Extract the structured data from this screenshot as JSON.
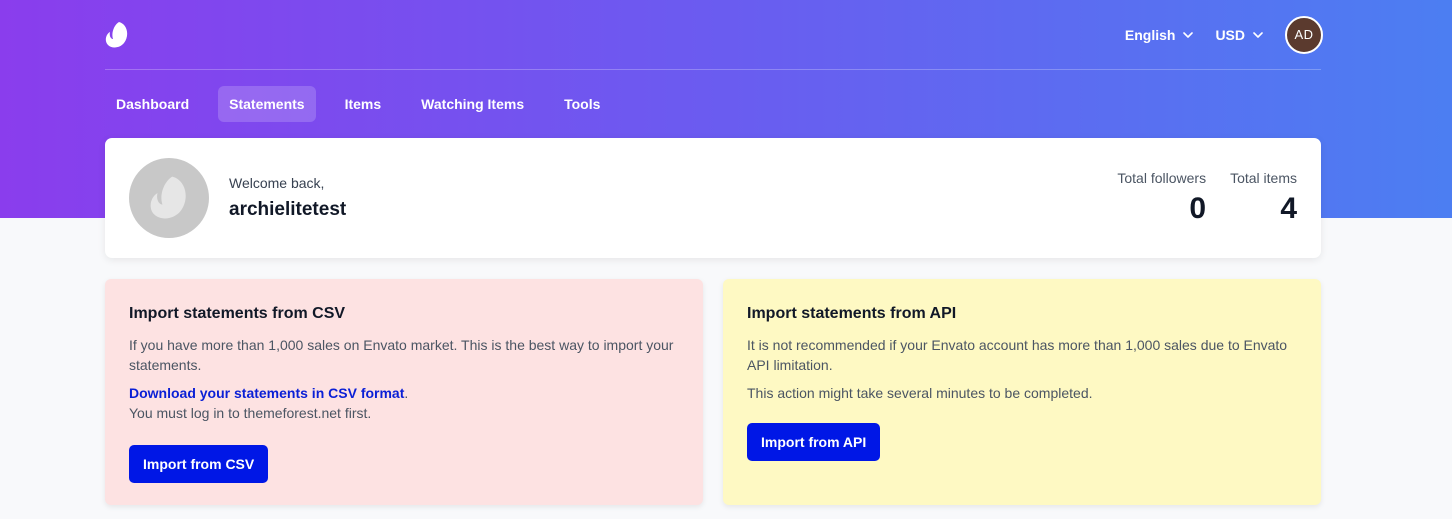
{
  "header": {
    "language": "English",
    "currency": "USD",
    "avatar_initials": "AD"
  },
  "nav": {
    "items": [
      {
        "label": "Dashboard",
        "active": false
      },
      {
        "label": "Statements",
        "active": true
      },
      {
        "label": "Items",
        "active": false
      },
      {
        "label": "Watching Items",
        "active": false
      },
      {
        "label": "Tools",
        "active": false
      }
    ]
  },
  "profile": {
    "welcome": "Welcome back,",
    "username": "archielitetest",
    "stats": [
      {
        "label": "Total followers",
        "value": "0"
      },
      {
        "label": "Total items",
        "value": "4"
      }
    ]
  },
  "csv_card": {
    "title": "Import statements from CSV",
    "description": "If you have more than 1,000 sales on Envato market. This is the best way to import your statements.",
    "link_text": "Download your statements in CSV format",
    "link_suffix": ".",
    "note": "You must log in to themeforest.net first.",
    "button": "Import from CSV"
  },
  "api_card": {
    "title": "Import statements from API",
    "description": "It is not recommended if your Envato account has more than 1,000 sales due to Envato API limitation.",
    "note": "This action might take several minutes to be completed.",
    "button": "Import from API"
  },
  "colors": {
    "gradient_start": "#8a3ded",
    "gradient_end": "#4c7ef2",
    "csv_card_bg": "#fde2e2",
    "api_card_bg": "#fef9c3",
    "primary_button": "#0017e6",
    "link": "#0a1fd6"
  },
  "icons": {
    "logo": "envato-leaf-icon",
    "chevron": "chevron-down-icon"
  }
}
